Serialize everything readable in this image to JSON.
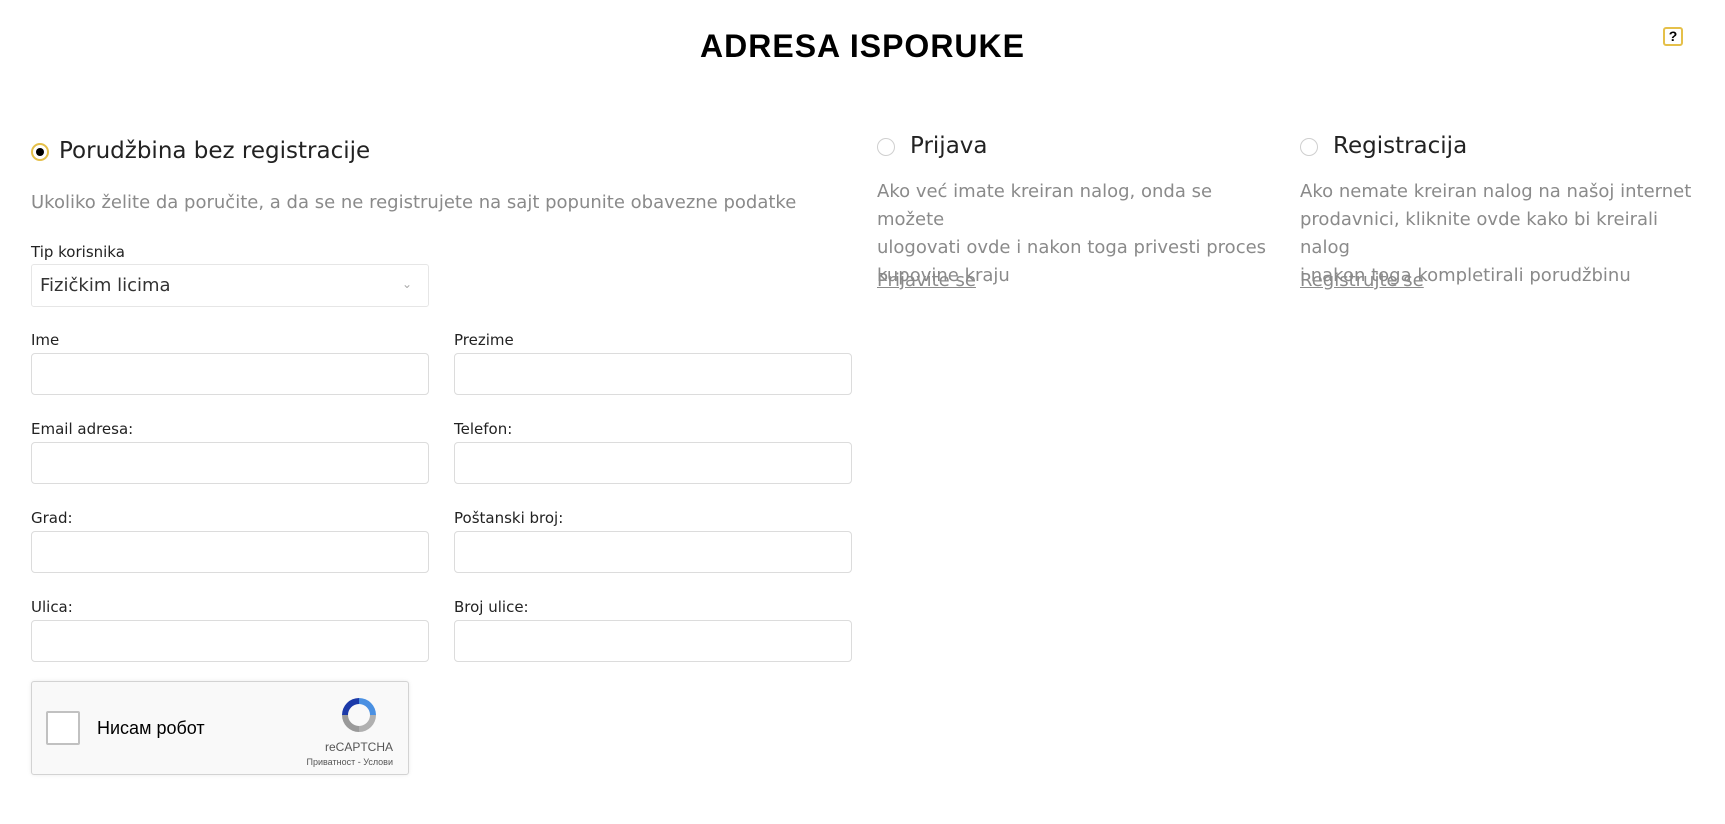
{
  "page": {
    "title": "ADRESA ISPORUKE",
    "help_label": "?"
  },
  "options": {
    "guest": {
      "title": "Porudžbina bez registracije",
      "description": "Ukoliko želite da poručite, a da se ne registrujete na sajt popunite obavezne podatke",
      "selected": true
    },
    "login": {
      "title": "Prijava",
      "description_lines": [
        "Ako već imate kreiran nalog, onda se možete",
        "ulogovati ovde i nakon toga privesti proces",
        "kupovine kraju"
      ],
      "link": "Prijavite se",
      "selected": false
    },
    "register": {
      "title": "Registracija",
      "description_lines": [
        "Ako nemate kreiran nalog na našoj internet",
        "prodavnici, kliknite ovde kako bi kreirali nalog",
        "i nakon toga kompletirali porudžbinu"
      ],
      "link": "Registrujte se",
      "selected": false
    }
  },
  "form": {
    "user_type": {
      "label": "Tip korisnika",
      "value": "Fizičkim licima"
    },
    "first_name": {
      "label": "Ime",
      "value": ""
    },
    "last_name": {
      "label": "Prezime",
      "value": ""
    },
    "email": {
      "label": "Email adresa:",
      "value": ""
    },
    "phone": {
      "label": "Telefon:",
      "value": ""
    },
    "city": {
      "label": "Grad:",
      "value": ""
    },
    "postal_code": {
      "label": "Poštanski broj:",
      "value": ""
    },
    "street": {
      "label": "Ulica:",
      "value": ""
    },
    "street_number": {
      "label": "Broj ulice:",
      "value": ""
    }
  },
  "captcha": {
    "label": "Нисам робот",
    "brand": "reCAPTCHA",
    "terms": "Приватност - Услови"
  },
  "colors": {
    "accent": "#e5c04a",
    "muted_text": "#8a8a8a",
    "border": "#dcdcdc"
  },
  "icons": {
    "help": "question-mark-icon",
    "select": "chevron-down-icon",
    "captcha_logo": "recaptcha-logo-icon"
  }
}
